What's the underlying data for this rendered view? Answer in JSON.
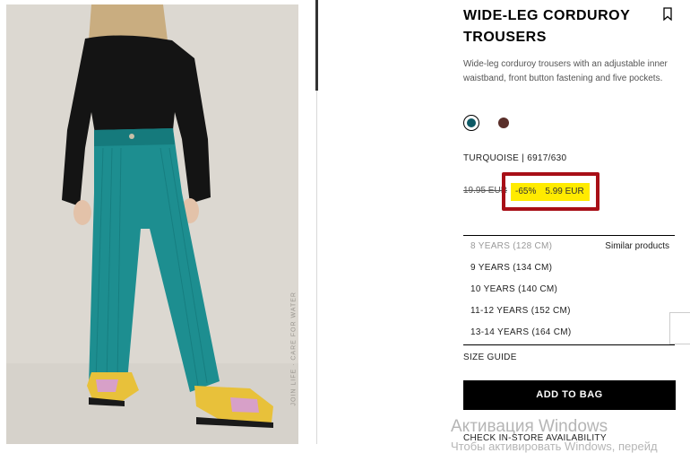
{
  "product": {
    "title": "WIDE-LEG CORDUROY TROUSERS",
    "description": "Wide-leg corduroy trousers with an adjustable inner waistband, front button fastening and five pockets.",
    "photo_credit": "JOIN LIFE · CARE FOR WATER",
    "color_code": "TURQUOISE | 6917/630",
    "swatches": [
      {
        "name": "turquoise",
        "color": "#0e5a66",
        "selected": true
      },
      {
        "name": "brown",
        "color": "#5a2f2a",
        "selected": false
      }
    ],
    "price": {
      "old": "19.95 EUR",
      "discount": "-65%",
      "new": "5.99 EUR",
      "highlight_color": "#ffeb00",
      "box_color": "#a80f17"
    }
  },
  "sizes": {
    "items": [
      {
        "label": "8 YEARS (128 CM)",
        "available": false
      },
      {
        "label": "9 YEARS (134 CM)",
        "available": true
      },
      {
        "label": "10 YEARS (140 CM)",
        "available": true
      },
      {
        "label": "11-12 YEARS (152 CM)",
        "available": true
      },
      {
        "label": "13-14 YEARS (164 CM)",
        "available": true
      }
    ],
    "similar_label": "Similar products"
  },
  "actions": {
    "size_guide": "SIZE GUIDE",
    "add_to_bag": "ADD TO BAG",
    "check_store": "CHECK IN-STORE AVAILABILITY"
  },
  "overlay": {
    "activate_title": "Активация Windows",
    "activate_sub": "Чтобы активировать Windows, перейд"
  }
}
